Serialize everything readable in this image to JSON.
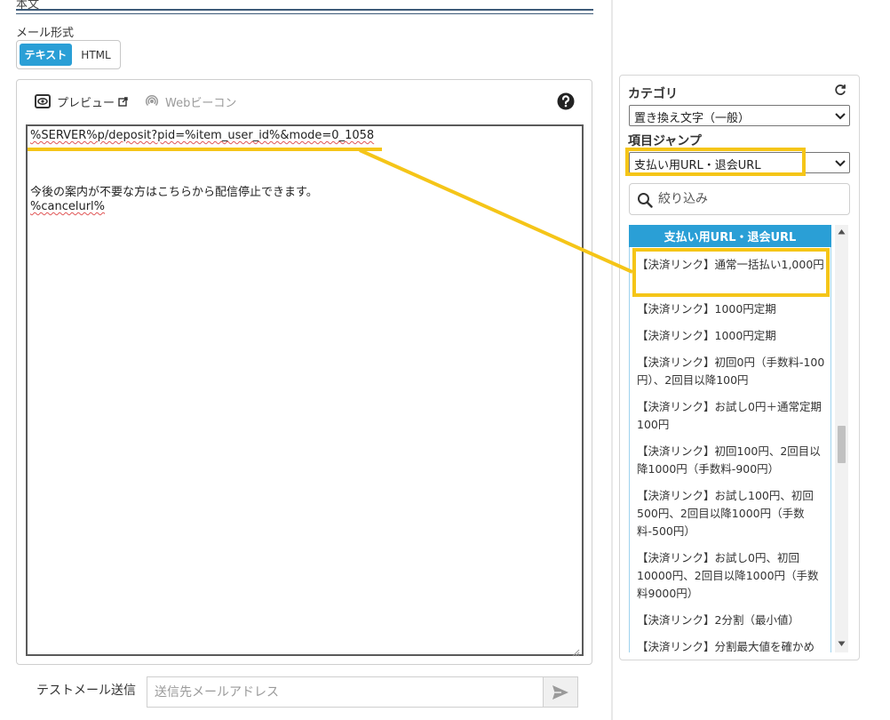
{
  "section": {
    "title": "本文"
  },
  "mail_format": {
    "label": "メール形式",
    "options": [
      "テキスト",
      "HTML"
    ],
    "selected": "テキスト"
  },
  "editor": {
    "preview_label": "プレビュー",
    "beacon_label": "Webビーコン",
    "lines": [
      "%SERVER%p/deposit?pid=%item_user_id%&mode=0_1058",
      "今後の案内が不要な方はこちらから配信停止できます。",
      "%cancelurl%"
    ]
  },
  "test_mail": {
    "label": "テストメール送信",
    "placeholder": "送信先メールアドレス"
  },
  "sidebar": {
    "category_label": "カテゴリ",
    "category_value": "置き換え文字（一般）",
    "jump_label": "項目ジャンプ",
    "jump_value": "支払い用URL・退会URL",
    "filter_placeholder": "絞り込み",
    "list_header": "支払い用URL・退会URL",
    "items": [
      "【決済リンク】通常一括払い1,000円",
      "【決済リンク】1000円定期",
      "【決済リンク】1000円定期",
      "【決済リンク】初回0円（手数料-100円）、2回目以降100円",
      "【決済リンク】お試し0円＋通常定期100円",
      "【決済リンク】初回100円、2回目以降1000円（手数料-900円）",
      "【決済リンク】お試し100円、初回500円、2回目以降1000円（手数料-500円）",
      "【決済リンク】お試し0円、初回10000円、2回目以降1000円（手数料9000円）",
      "【決済リンク】2分割（最小値）",
      "【決済リンク】分割最大値を確かめ"
    ]
  },
  "colors": {
    "accent": "#2a9fd6",
    "highlight": "#f5c518",
    "rule": "#3d5a78"
  }
}
